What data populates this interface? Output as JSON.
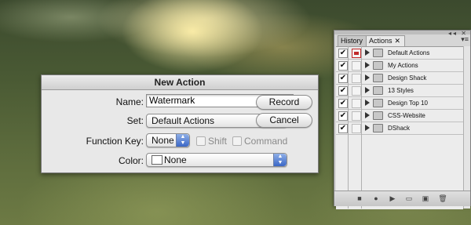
{
  "dialog": {
    "title": "New Action",
    "name_label": "Name:",
    "name_value": "Watermark",
    "set_label": "Set:",
    "set_value": "Default Actions",
    "function_key_label": "Function Key:",
    "function_key_value": "None",
    "shift_label": "Shift",
    "command_label": "Command",
    "color_label": "Color:",
    "color_value": "None",
    "record_label": "Record",
    "cancel_label": "Cancel"
  },
  "panel": {
    "tabs": [
      {
        "label": "History"
      },
      {
        "label": "Actions"
      }
    ],
    "rows": [
      {
        "label": "Default Actions",
        "checked": true,
        "dialog_toggle": "red"
      },
      {
        "label": "My Actions",
        "checked": true,
        "dialog_toggle": "empty"
      },
      {
        "label": "Design Shack",
        "checked": true,
        "dialog_toggle": "empty"
      },
      {
        "label": "13 Styles",
        "checked": true,
        "dialog_toggle": "empty"
      },
      {
        "label": "Design Top 10",
        "checked": true,
        "dialog_toggle": "empty"
      },
      {
        "label": "CSS-Website",
        "checked": true,
        "dialog_toggle": "empty"
      },
      {
        "label": "DShack",
        "checked": true,
        "dialog_toggle": "empty"
      }
    ],
    "toolbar_icons": [
      "stop-icon",
      "record-icon",
      "play-icon",
      "folder-icon",
      "new-action-icon",
      "trash-icon"
    ]
  },
  "colors": {
    "accent": "#3b67c6",
    "dialog_bg": "#e8e8e8"
  }
}
